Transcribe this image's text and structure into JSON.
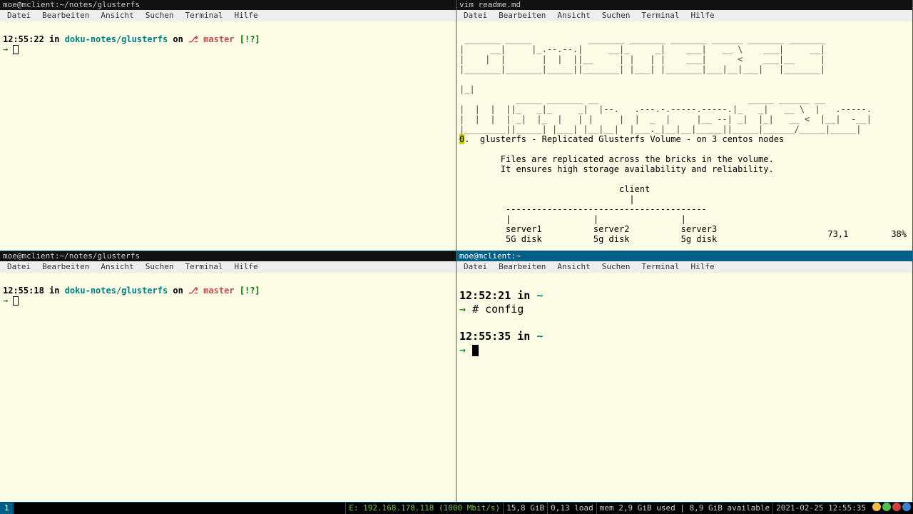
{
  "menus": [
    "Datei",
    "Bearbeiten",
    "Ansicht",
    "Suchen",
    "Terminal",
    "Hilfe"
  ],
  "panes": {
    "tl": {
      "title": "moe@mclient:~/notes/glusterfs",
      "prompt": {
        "time": "12:55:22",
        "in": " in ",
        "path": "doku-notes/glusterfs",
        "on": " on ",
        "glyph": "⎇ ",
        "branch": "master ",
        "status": "[!?]"
      }
    },
    "tr": {
      "title": "vim readme.md",
      "ascii": " _______ _____           _______ _______ _______ ______ _______ _______\n|     __|     |_.--.--.|     __|_     _|    ___|   __ \\    ___|     __|\n|    |  |       |  |  ||__     | |   | |    ___|      <    ___|__     |\n|_______|_______|_____||_______| |___| |_______|___|__|___|   |_______|\n                                                                      \n|_|\n           _____ _______ __                             _____ ______ __\n|  |  |  ||_   _|_     _|  |--.   .---.-.-----.-----.|_   _|   __ \\  |   .-----.\n|  |  |  | _|  |_  |   | |     |  |  _  |     |__ --| _|  |_|   __ <  |__|  -__|\n|________||_____| |___| |__|__|  |___._|__|__|_____||_____|______/_____|_____|",
      "line1": ".  glusterfs - Replicated Glusterfs Volume - on 3 centos nodes",
      "body": "\n        Files are replicated across the bricks in the volume.\n        It ensures high storage availability and reliability.\n\n                               client\n                                 |\n         ---------------------------------------\n         |                |                |\n         server1          server2          server3\n         5G disk          5g disk          5g disk",
      "vim_pos": "73,1",
      "vim_pct": "38%"
    },
    "bl": {
      "title": "moe@mclient:~/notes/glusterfs",
      "prompt": {
        "time": "12:55:18",
        "in": " in ",
        "path": "doku-notes/glusterfs",
        "on": " on ",
        "glyph": "⎇ ",
        "branch": "master ",
        "status": "[!?]"
      }
    },
    "br": {
      "title": "moe@mclient:~",
      "line1": {
        "time": "12:52:21",
        "in": " in ",
        "path": "~"
      },
      "cmd": "# config",
      "line2": {
        "time": "12:55:35",
        "in": " in ",
        "path": "~"
      }
    }
  },
  "statusbar": {
    "workspace": "1",
    "net": "E: 192.168.178.118 (1000 Mbit/s)",
    "disk": "15,8 GiB",
    "load": "0,13 load",
    "mem": "mem 2,9 GiB used | 8,9 GiB available",
    "datetime": "2021-02-25 12:55:35",
    "tray_colors": [
      "#f0c040",
      "#50c050",
      "#d04040",
      "#4080d0"
    ]
  }
}
